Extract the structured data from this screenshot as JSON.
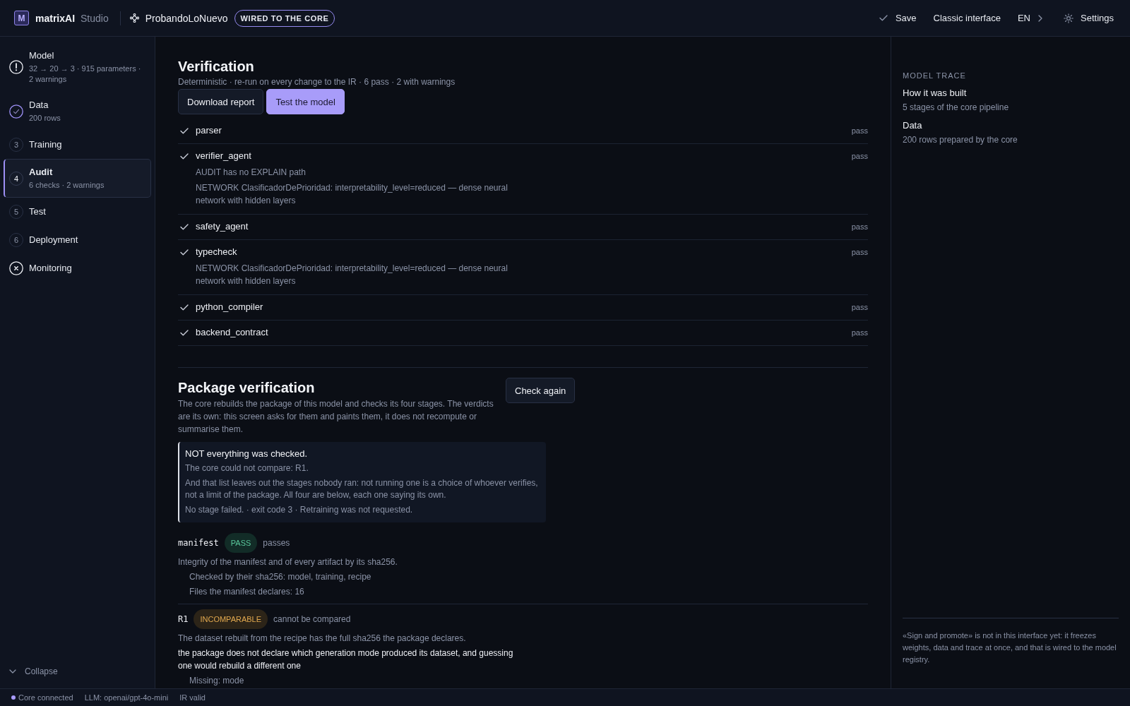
{
  "topbar": {
    "logo": "M",
    "app_name": "matrixAI",
    "edition": "Studio",
    "project": "ProbandoLoNuevo",
    "badge": "WIRED TO THE CORE",
    "actions": [
      {
        "kind": "save",
        "label": "Save"
      },
      {
        "kind": "link",
        "label": "Classic interface"
      },
      {
        "kind": "language",
        "label": "EN"
      },
      {
        "kind": "settings",
        "label": "Settings"
      }
    ]
  },
  "sidebar": {
    "steps": [
      {
        "kind": "warning",
        "label": "Model",
        "detail": "32 → 20 → 3 · 915 parameters · 2 warnings",
        "selected": false
      },
      {
        "kind": "done",
        "label": "Data",
        "detail": "200 rows",
        "selected": false
      },
      {
        "kind": "number",
        "number": "3",
        "label": "Training",
        "selected": false
      },
      {
        "kind": "number",
        "number": "4",
        "label": "Audit",
        "detail": "6 checks · 2 warnings",
        "selected": true
      },
      {
        "kind": "number",
        "number": "5",
        "label": "Test",
        "selected": false
      },
      {
        "kind": "number",
        "number": "6",
        "label": "Deployment",
        "selected": false
      },
      {
        "kind": "error",
        "label": "Monitoring",
        "selected": false
      }
    ],
    "collapse": "Collapse"
  },
  "verification": {
    "title": "Verification",
    "subtitle": "Deterministic · re-run on every change to the IR · 6 pass · 2 with warnings",
    "buttons": [
      {
        "kind": "secondary",
        "label": "Download report"
      },
      {
        "kind": "primary",
        "label": "Test the model"
      }
    ],
    "checks": [
      {
        "name": "parser",
        "passed": true,
        "result": "pass"
      },
      {
        "name": "verifier_agent",
        "passed": true,
        "result": "pass",
        "details": [
          "AUDIT has no EXPLAIN path",
          "NETWORK ClasificadorDePrioridad: interpretability_level=reduced — dense neural network with hidden layers"
        ]
      },
      {
        "name": "safety_agent",
        "passed": true,
        "result": "pass"
      },
      {
        "name": "typecheck",
        "passed": true,
        "result": "pass",
        "details": [
          "NETWORK ClasificadorDePrioridad: interpretability_level=reduced — dense neural network with hidden layers"
        ]
      },
      {
        "name": "python_compiler",
        "passed": true,
        "result": "pass"
      },
      {
        "name": "backend_contract",
        "passed": true,
        "result": "pass"
      }
    ]
  },
  "package_verification": {
    "title": "Package verification",
    "description": "The core rebuilds the package of this model and checks its four stages. The verdicts are its own: this screen asks for them and paints them, it does not recompute or summarise them.",
    "button": "Check again",
    "notice": {
      "title": "NOT everything was checked.",
      "lines": [
        "The core could not compare: R1.",
        "And that list leaves out the stages nobody ran: not running one is a choice of whoever verifies, not a limit of the package. All four are below, each one saying its own.",
        "No stage failed. · exit code 3 · Retraining was not requested."
      ]
    },
    "stages": [
      {
        "name": "manifest",
        "kind": "pass",
        "verdict": "PASS",
        "summary": "passes",
        "description": "Integrity of the manifest and of every artifact by its sha256.",
        "details": [
          "Checked by their sha256: model, training, recipe",
          "Files the manifest declares: 16"
        ]
      },
      {
        "name": "R1",
        "kind": "incomparable",
        "verdict": "INCOMPARABLE",
        "summary": "cannot be compared",
        "description": "The dataset rebuilt from the recipe has the full sha256 the package declares.",
        "reason": "the package does not declare which generation mode produced its dataset, and guessing one would rebuild a different one",
        "details": [
          "Missing: mode"
        ]
      }
    ]
  },
  "model_trace": {
    "heading": "MODEL TRACE",
    "items": [
      {
        "title": "How it was built",
        "detail": "5 stages of the core pipeline"
      },
      {
        "title": "Data",
        "detail": "200 rows prepared by the core"
      }
    ],
    "note": "«Sign and promote» is not in this interface yet: it freezes weights, data and trace at once, and that is wired to the model registry."
  },
  "status_bar": {
    "items": [
      {
        "kind": "indicator",
        "label": "Core connected"
      },
      {
        "kind": "text",
        "label": "LLM: openai/gpt-4o-mini"
      },
      {
        "kind": "text",
        "label": "IR valid"
      }
    ]
  }
}
